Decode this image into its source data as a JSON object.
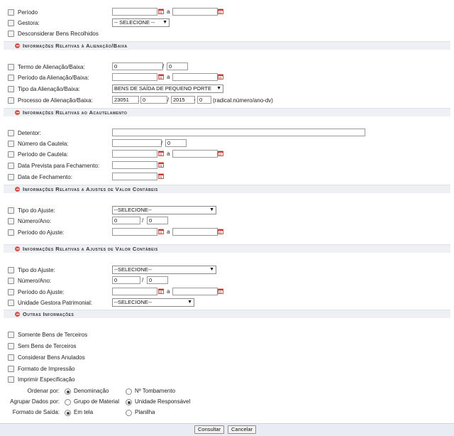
{
  "filters": {
    "periodo": "Período",
    "gestora": "Gestora:",
    "gestora_select": "-- SELECIONE --",
    "desconsiderar": "Desconsiderar Bens Recolhidos",
    "a": "a"
  },
  "alienacao": {
    "title": "Informações Relativas à Alienação/Baixa",
    "termo": "Termo de Alienação/Baixa:",
    "termo_num": "0",
    "termo_ano": "0",
    "periodo": "Período da Alienação/Baixa:",
    "tipo": "Tipo da Alienação/Baixa:",
    "tipo_select": "BENS DE SAÍDA DE PEQUENO PORTE",
    "processo": "Processo de Alienação/Baixa:",
    "proc_radical": "23051",
    "proc_numero": "0",
    "proc_ano": "2015",
    "proc_dv": "0",
    "proc_hint": "(radical.número/ano-dv)"
  },
  "acautelamento": {
    "title": "Informações Relativas ao Acautelamento",
    "detentor": "Detentor:",
    "numero": "Número da Cautela:",
    "numero_val": "0",
    "periodo": "Período de Cautela:",
    "prevista": "Data Prevista para Fechamento:",
    "fechamento": "Data de Fechamento:"
  },
  "ajustes1": {
    "title": "Informações Relativas a Ajustes de Valor Contábeis",
    "tipo": "Tipo do Ajuste:",
    "tipo_select": "--SELECIONE--",
    "numero": "Número/Ano:",
    "num_val": "0",
    "ano_val": "0",
    "periodo": "Período do Ajuste:"
  },
  "ajustes2": {
    "title": "Informações Relativas a Ajustes de Valor Contábeis",
    "tipo": "Tipo do Ajuste:",
    "tipo_select": "--SELECIONE--",
    "numero": "Número/Ano:",
    "num_val": "0",
    "ano_val": "0",
    "periodo": "Período do Ajuste:",
    "unidade": "Unidade Gestora Patrimonial:",
    "unidade_select": "--SELECIONE--"
  },
  "outras": {
    "title": "Outras Informações",
    "terceiros": "Somente Bens de Terceiros",
    "sem_terceiros": "Sem Bens de Terceiros",
    "anulados": "Considerar Bens Anulados",
    "formato": "Formato de Impressão",
    "imprimir": "Imprimir Especificação",
    "ordenar": "Ordenar por:",
    "ord_den": "Denominação",
    "ord_tomb": "Nº Tombamento",
    "agrupar": "Agrupar Dados por:",
    "agr_grupo": "Grupo de Material",
    "agr_unid": "Unidade Responsável",
    "saida": "Formato de Saída:",
    "sai_tela": "Em tela",
    "sai_plan": "Planilha"
  },
  "buttons": {
    "consultar": "Consultar",
    "cancelar": "Cancelar"
  },
  "colors": {
    "section_bg": "#eef0f4",
    "minus_icon": "#d9534f",
    "calendar": "#c0392b"
  }
}
